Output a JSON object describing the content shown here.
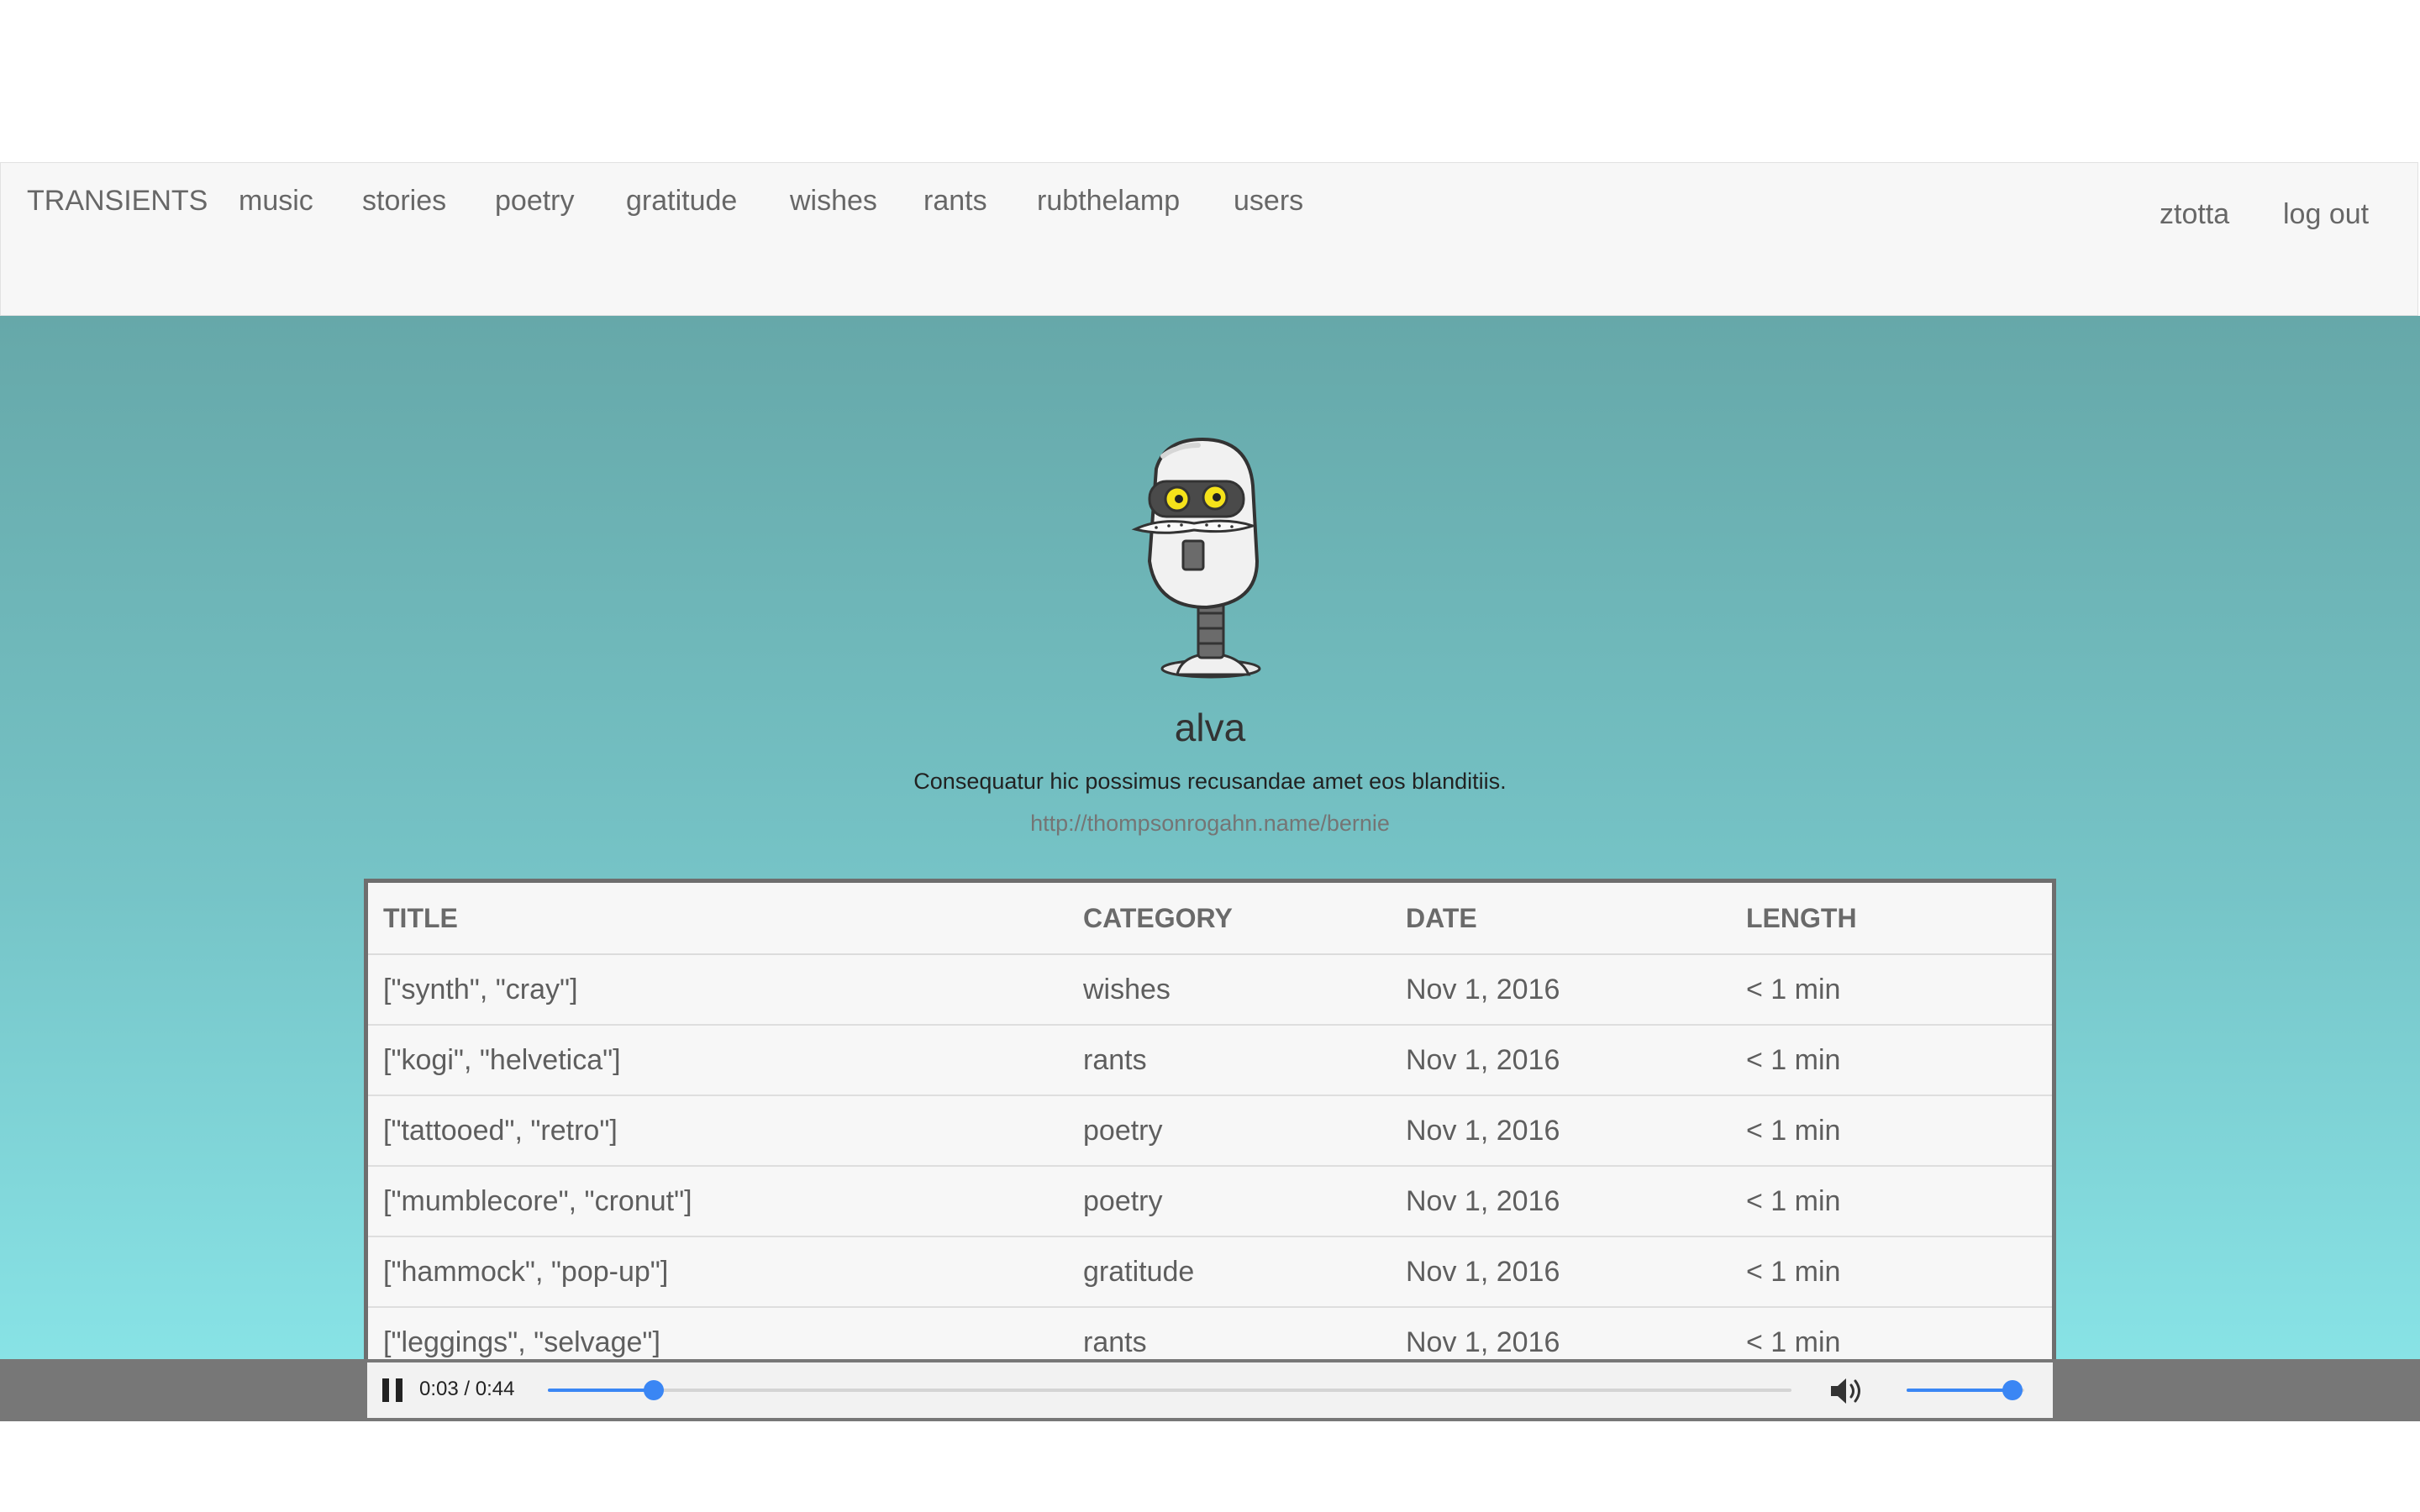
{
  "nav": {
    "brand": "TRANSIENTS",
    "links": [
      "music",
      "stories",
      "poetry",
      "gratitude",
      "wishes",
      "rants",
      "rubthelamp",
      "users"
    ],
    "user": "ztotta",
    "logout": "log out"
  },
  "profile": {
    "username": "alva",
    "bio": "Consequatur hic possimus recusandae amet eos blanditiis.",
    "website": "http://thompsonrogahn.name/bernie",
    "avatar_icon": "robot-avatar-icon"
  },
  "table": {
    "headers": [
      "TITLE",
      "CATEGORY",
      "DATE",
      "LENGTH"
    ],
    "rows": [
      {
        "title": "[\"synth\", \"cray\"]",
        "category": "wishes",
        "date": "Nov 1, 2016",
        "length": "< 1 min"
      },
      {
        "title": "[\"kogi\", \"helvetica\"]",
        "category": "rants",
        "date": "Nov 1, 2016",
        "length": "< 1 min"
      },
      {
        "title": "[\"tattooed\", \"retro\"]",
        "category": "poetry",
        "date": "Nov 1, 2016",
        "length": "< 1 min"
      },
      {
        "title": "[\"mumblecore\", \"cronut\"]",
        "category": "poetry",
        "date": "Nov 1, 2016",
        "length": "< 1 min"
      },
      {
        "title": "[\"hammock\", \"pop-up\"]",
        "category": "gratitude",
        "date": "Nov 1, 2016",
        "length": "< 1 min"
      },
      {
        "title": "[\"leggings\", \"selvage\"]",
        "category": "rants",
        "date": "Nov 1, 2016",
        "length": "< 1 min"
      }
    ]
  },
  "player": {
    "time": "0:03 / 0:44",
    "progress_fraction": 0.085,
    "volume_fraction": 0.9,
    "state": "playing"
  },
  "colors": {
    "accent": "#3a86f4",
    "hero_top": "#66a8a9",
    "hero_bottom": "#88e3e6"
  }
}
